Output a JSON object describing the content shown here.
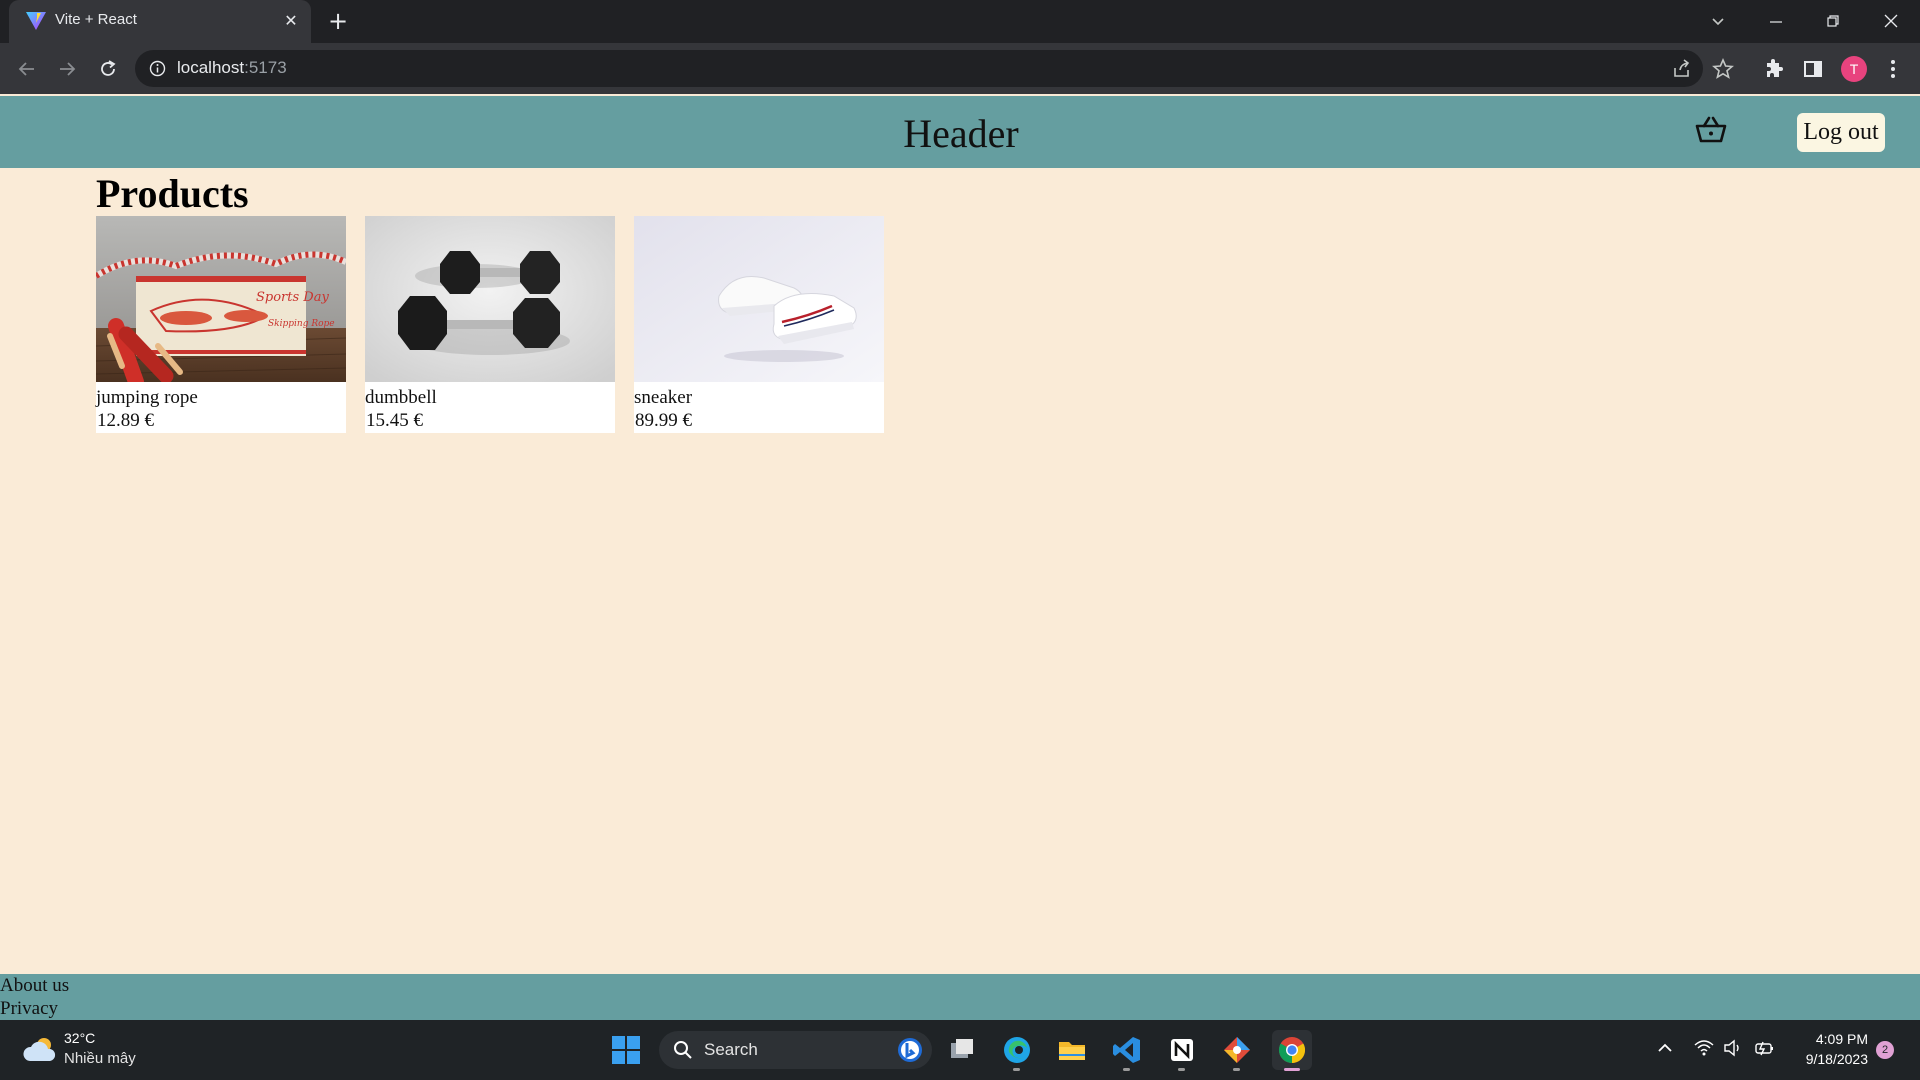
{
  "browser": {
    "tab_title": "Vite + React",
    "url_host": "localhost",
    "url_port": ":5173",
    "profile_initial": "T",
    "colors": {
      "frame": "#202124",
      "toolbar": "#35363a",
      "profile": "#e8437e"
    }
  },
  "header": {
    "title": "Header",
    "cart_icon": "basket-icon",
    "logout_label": "Log out"
  },
  "main": {
    "title": "Products",
    "products": [
      {
        "name": "jumping rope",
        "price": "12.89 €"
      },
      {
        "name": "dumbbell",
        "price": "15.45 €"
      },
      {
        "name": "sneaker",
        "price": "89.99 €"
      }
    ]
  },
  "footer": {
    "links": [
      "About us",
      "Privacy"
    ]
  },
  "taskbar": {
    "weather_temp": "32°C",
    "weather_desc": "Nhiều mây",
    "search_placeholder": "Search",
    "time": "4:09 PM",
    "date": "9/18/2023",
    "notification_count": "2"
  },
  "theme": {
    "page_bg": "#faebd7",
    "header_bg": "#659ea0",
    "button_bg": "#fbf6e2"
  }
}
